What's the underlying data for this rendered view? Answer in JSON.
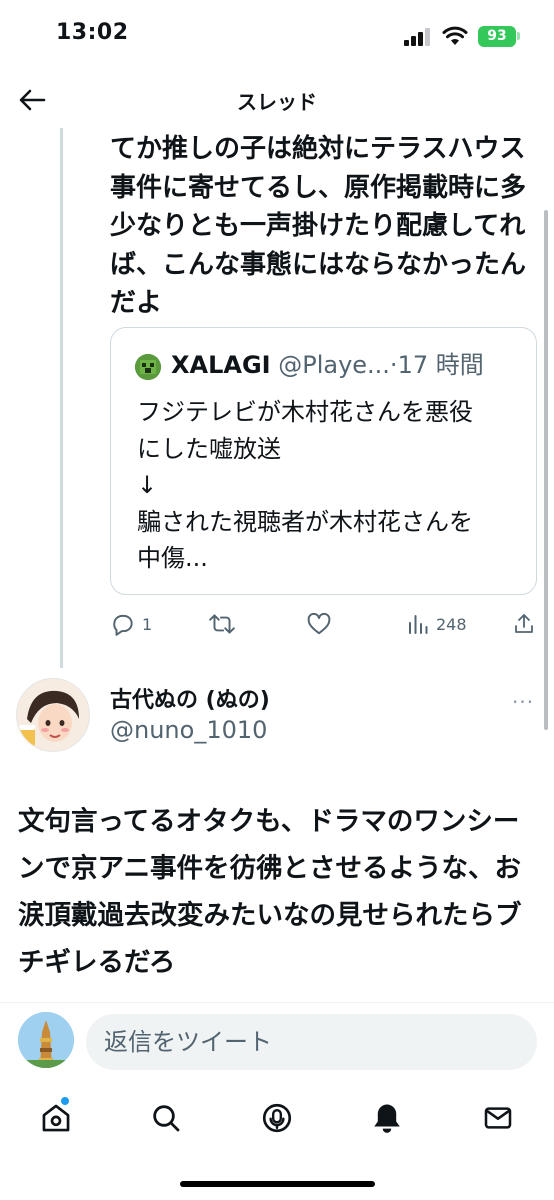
{
  "status_bar": {
    "time": "13:02",
    "battery": "93"
  },
  "header": {
    "title": "スレッド"
  },
  "tweet": {
    "text": "てか推しの子は絶対にテラスハウス事件に寄せてるし、原作掲載時に多少なりとも一声掛けたり配慮してれば、こんな事態にはならなかったんだよ",
    "quote": {
      "name": "XALAGI",
      "handle": "@Playe...",
      "separator": "·",
      "time": "17 時間",
      "text_lines": [
        "フジテレビが木村花さんを悪役",
        "にした嘘放送",
        "↓",
        "騙された視聴者が木村花さんを",
        "中傷..."
      ]
    },
    "actions": {
      "replies": "1",
      "views": "248"
    }
  },
  "reply": {
    "name": "古代ぬの (ぬの)",
    "handle": "@nuno_1010",
    "more": "···",
    "text": "文句言ってるオタクも、ドラマのワンシーンで京アニ事件を彷彿とさせるような、お涙頂戴過去改変みたいなの見せられたらブチギレるだろ"
  },
  "composer": {
    "placeholder": "返信をツイート"
  },
  "icons": {
    "back": "arrow-left-icon",
    "reply": "reply-icon",
    "retweet": "retweet-icon",
    "like": "heart-icon",
    "views": "bar-chart-icon",
    "share": "share-icon",
    "home": "home-icon",
    "search": "search-icon",
    "spaces": "spaces-icon",
    "notifications": "bell-icon",
    "messages": "mail-icon"
  },
  "colors": {
    "accent": "#1d9bf0",
    "secondary_text": "#536471",
    "battery": "#34c759"
  }
}
